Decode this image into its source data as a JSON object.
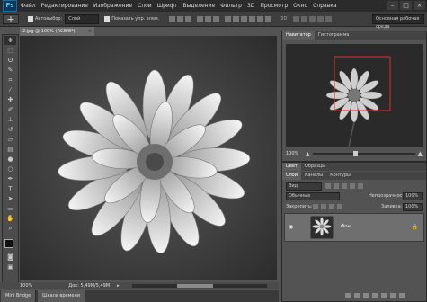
{
  "app": {
    "logo": "Ps"
  },
  "menu": [
    "Файл",
    "Редактирование",
    "Изображение",
    "Слои",
    "Шрифт",
    "Выделение",
    "Фильтр",
    "3D",
    "Просмотр",
    "Окно",
    "Справка"
  ],
  "window_controls": [
    "–",
    "□",
    "×"
  ],
  "options_bar": {
    "autoselect_label": "Автовыбор:",
    "autoselect_value": "Слой",
    "show_controls_label": "Показать упр. элем.",
    "workspace": "Основная рабочая среда"
  },
  "tools": [
    "move",
    "marquee",
    "lasso",
    "quick-select",
    "crop",
    "eyedropper",
    "healing",
    "brush",
    "stamp",
    "history",
    "eraser",
    "gradient",
    "blur",
    "dodge",
    "pen",
    "type",
    "path-select",
    "shape",
    "hand",
    "zoom"
  ],
  "document": {
    "tab_title": "2.jpg @ 100% (RGB/8*)",
    "close_label": "×",
    "zoom": "100%",
    "doc_info": "Док: 5,49M/5,49M"
  },
  "bottom_tabs": [
    "Mini Bridge",
    "Шкала времени"
  ],
  "navigator": {
    "tabs": [
      "Навигатор",
      "Гистограмма"
    ],
    "zoom": "100%"
  },
  "layers_panel": {
    "top_tabs": [
      "Цвет",
      "Образцы"
    ],
    "tabs": [
      "Слои",
      "Каналы",
      "Контуры"
    ],
    "kind_filter": "Вид",
    "blend_mode": "Обычные",
    "opacity_label": "Непрозрачность:",
    "opacity_value": "100%",
    "lock_label": "Закрепить:",
    "fill_label": "Заливка:",
    "fill_value": "100%",
    "layer_name": "Фон"
  }
}
